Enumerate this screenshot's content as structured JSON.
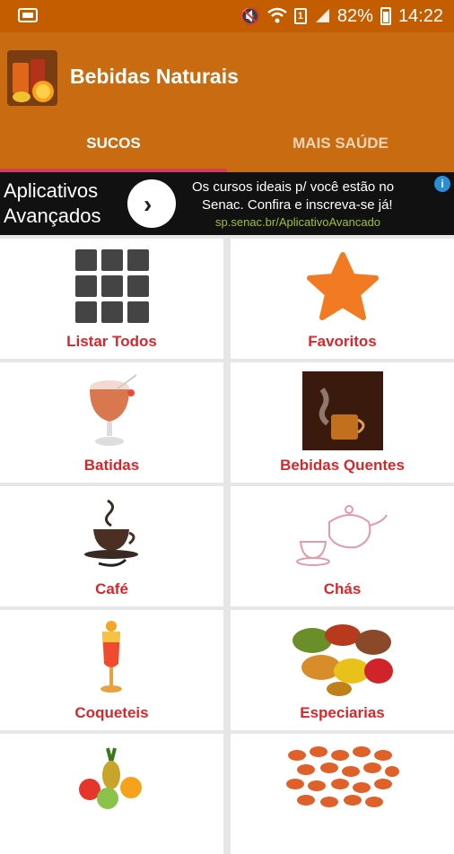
{
  "status": {
    "battery": "82%",
    "time": "14:22",
    "sim_slot": "1"
  },
  "app": {
    "title": "Bebidas Naturais"
  },
  "tabs": [
    {
      "label": "SUCOS"
    },
    {
      "label": "MAIS SAÚDE"
    }
  ],
  "ad": {
    "brand_line1": "Aplicativos",
    "brand_line2": "Avançados",
    "text_line1": "Os cursos ideais p/ você estão no",
    "text_line2": "Senac. Confira e inscreva-se já!",
    "url": "sp.senac.br/AplicativoAvancado"
  },
  "categories": [
    {
      "label": "Listar Todos"
    },
    {
      "label": "Favoritos"
    },
    {
      "label": "Batidas"
    },
    {
      "label": "Bebidas Quentes"
    },
    {
      "label": "Café"
    },
    {
      "label": "Chás"
    },
    {
      "label": "Coqueteis"
    },
    {
      "label": "Especiarias"
    },
    {
      "label": ""
    },
    {
      "label": ""
    }
  ],
  "colors": {
    "status_bar": "#c45c00",
    "app_bar": "#c96b10",
    "tab_indicator": "#d43a5a",
    "label_red": "#d8272b"
  }
}
